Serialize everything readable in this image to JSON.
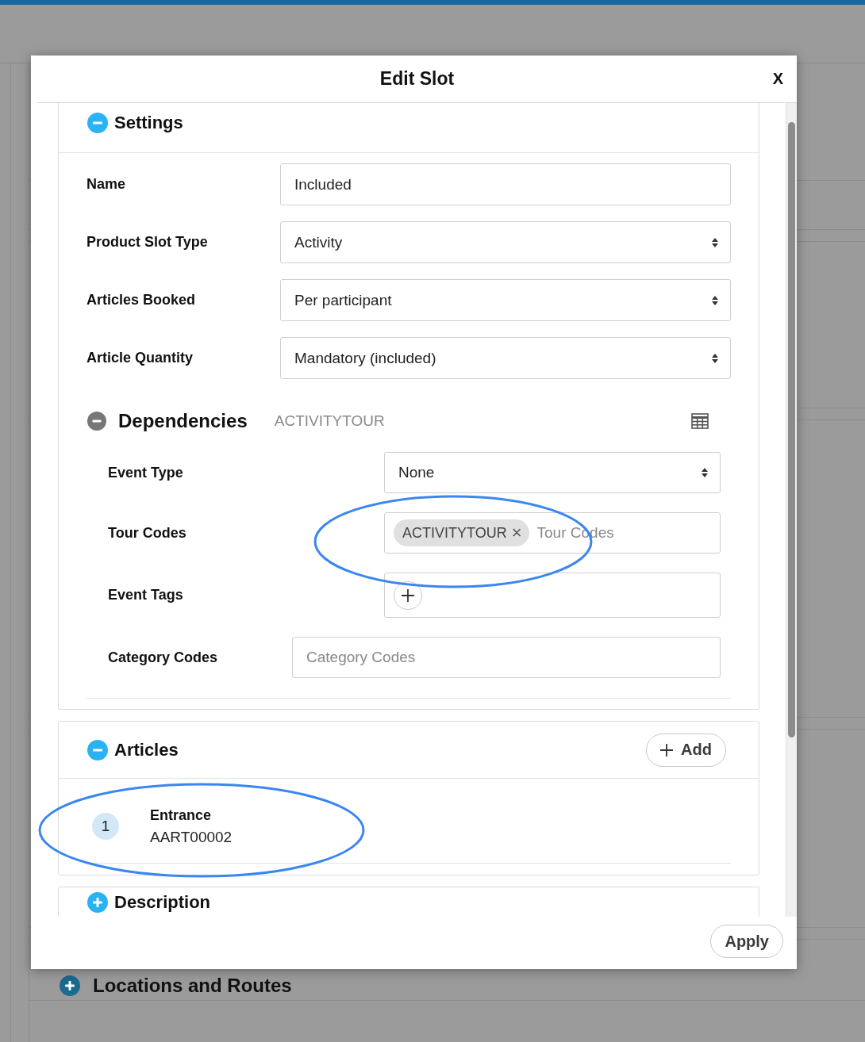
{
  "background_page": {
    "section_title": "Locations and Routes",
    "expanded": false
  },
  "dialog": {
    "title": "Edit Slot",
    "close": "X",
    "sections": [
      {
        "kind": "settings",
        "title": "Settings",
        "expanded": true,
        "fields": [
          {
            "kind": "text",
            "label": "Name",
            "value": "Included"
          },
          {
            "kind": "select",
            "label": "Product Slot Type",
            "value": "Activity"
          },
          {
            "kind": "select",
            "label": "Articles Booked",
            "value": "Per participant"
          },
          {
            "kind": "select",
            "label": "Article Quantity",
            "value": "Mandatory (included)"
          }
        ],
        "dependencies": {
          "title": "Dependencies",
          "expanded": true,
          "summary": "ACTIVITYTOUR",
          "fields": [
            {
              "kind": "select",
              "label": "Event Type",
              "value": "None"
            },
            {
              "kind": "tags",
              "label": "Tour Codes",
              "tags": [
                {
                  "label": "ACTIVITYTOUR",
                  "remove": "×"
                }
              ],
              "placeholder": "Tour Codes"
            },
            {
              "kind": "tag_add",
              "label": "Event Tags"
            },
            {
              "kind": "text",
              "label": "Category Codes",
              "placeholder": "Category Codes"
            }
          ]
        }
      },
      {
        "kind": "articles",
        "title": "Articles",
        "expanded": true,
        "add_button": "Add",
        "items": [
          {
            "number": "1",
            "name": "Entrance",
            "code": "AART00002"
          }
        ]
      },
      {
        "kind": "description",
        "title": "Description",
        "expanded": false
      }
    ],
    "apply_button": "Apply"
  }
}
